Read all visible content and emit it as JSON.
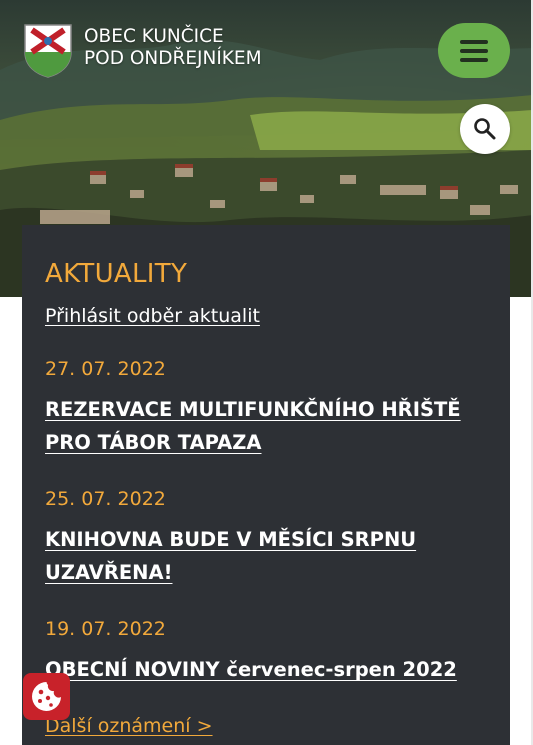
{
  "header": {
    "title_line1": "OBEC KUNČICE",
    "title_line2": "POD ONDŘEJNÍKEM",
    "logo_icon": "coat-of-arms-icon",
    "menu_icon": "hamburger-menu-icon",
    "search_icon": "search-icon"
  },
  "colors": {
    "accent": "#f2a93b",
    "menu_button": "#6ab04c",
    "panel_bg": "#2d3035",
    "cookie_button": "#c8222a"
  },
  "news": {
    "heading": "AKTUALITY",
    "subscribe": "Přihlásit odběr aktualit",
    "items": [
      {
        "date": "27. 07. 2022",
        "title": "REZERVACE  MULTIFUNKČNÍHO  HŘIŠTĚ PRO  TÁBOR  TAPAZA"
      },
      {
        "date": "25. 07. 2022",
        "title": "KNIHOVNA BUDE V MĚSÍCI SRPNU UZAVŘENA!"
      },
      {
        "date": "19. 07. 2022",
        "title": "OBECNÍ NOVINY červenec-srpen 2022"
      }
    ],
    "more": "Další oznámení >"
  },
  "cookie": {
    "icon": "cookie-icon"
  }
}
